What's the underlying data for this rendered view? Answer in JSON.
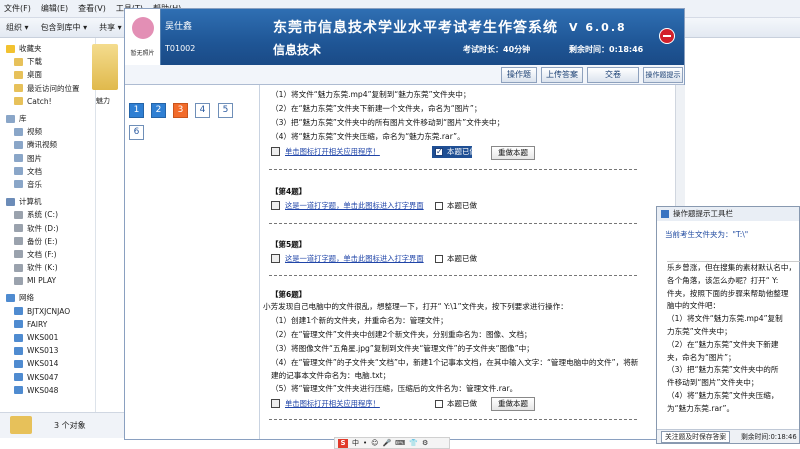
{
  "explorer": {
    "menu": [
      "文件(F)",
      "编辑(E)",
      "查看(V)",
      "工具(T)",
      "帮助(H)"
    ],
    "toolbar": [
      "组织 ▾",
      "包含到库中 ▾",
      "共享 ▾"
    ],
    "nav": [
      {
        "label": "收藏夹",
        "icon": "star-icon",
        "sub": false
      },
      {
        "label": "下载",
        "icon": "folder-icon",
        "sub": true
      },
      {
        "label": "桌面",
        "icon": "folder-icon",
        "sub": true
      },
      {
        "label": "最近访问的位置",
        "icon": "folder-icon",
        "sub": true
      },
      {
        "label": "Catch!",
        "icon": "folder-icon",
        "sub": true
      },
      {
        "label": "",
        "icon": "",
        "sub": false
      },
      {
        "label": "库",
        "icon": "library-icon",
        "sub": false
      },
      {
        "label": "视频",
        "icon": "library-icon",
        "sub": true
      },
      {
        "label": "腾讯视频",
        "icon": "library-icon",
        "sub": true
      },
      {
        "label": "图片",
        "icon": "library-icon",
        "sub": true
      },
      {
        "label": "文档",
        "icon": "library-icon",
        "sub": true
      },
      {
        "label": "音乐",
        "icon": "library-icon",
        "sub": true
      },
      {
        "label": "",
        "icon": "",
        "sub": false
      },
      {
        "label": "计算机",
        "icon": "computer-icon",
        "sub": false
      },
      {
        "label": "系统 (C:)",
        "icon": "drive-icon",
        "sub": true
      },
      {
        "label": "软件 (D:)",
        "icon": "drive-icon",
        "sub": true
      },
      {
        "label": "备份 (E:)",
        "icon": "drive-icon",
        "sub": true
      },
      {
        "label": "文档 (F:)",
        "icon": "drive-icon",
        "sub": true
      },
      {
        "label": "软件 (K:)",
        "icon": "drive-icon",
        "sub": true
      },
      {
        "label": "MI PLAY",
        "icon": "drive-icon",
        "sub": true
      },
      {
        "label": "",
        "icon": "",
        "sub": false
      },
      {
        "label": "网络",
        "icon": "network-icon",
        "sub": false
      },
      {
        "label": "BJTXJCNJAO",
        "icon": "network-icon",
        "sub": true
      },
      {
        "label": "FAIRY",
        "icon": "network-icon",
        "sub": true
      },
      {
        "label": "WKS001",
        "icon": "network-icon",
        "sub": true
      },
      {
        "label": "WKS013",
        "icon": "network-icon",
        "sub": true
      },
      {
        "label": "WKS014",
        "icon": "network-icon",
        "sub": true
      },
      {
        "label": "WKS047",
        "icon": "network-icon",
        "sub": true
      },
      {
        "label": "WKS048",
        "icon": "network-icon",
        "sub": true
      }
    ],
    "folder_label": "魅力",
    "status": "3 个对象"
  },
  "exam": {
    "photo_caption": "暂无照片",
    "student_name": "吴仕鑫",
    "student_id": "T01002",
    "system_title": "东莞市信息技术学业水平考试考生作答系统",
    "subject": "信息技术",
    "version": "V 6.0.8",
    "duration": "考试时长：40分钟",
    "remaining": "剩余时间：0:18:46",
    "toolbar": [
      "操作题",
      "上传答案",
      "交卷",
      "操作题提示"
    ],
    "questions": [
      {
        "label": "1",
        "state": "done"
      },
      {
        "label": "2",
        "state": "done"
      },
      {
        "label": "3",
        "state": "current"
      },
      {
        "label": "4",
        "state": "normal"
      },
      {
        "label": "5",
        "state": "normal"
      },
      {
        "label": "6",
        "state": "normal"
      }
    ],
    "q3_lines": [
      "（1）将文件“魅力东莞.mp4”复制到“魅力东莞”文件夹中；",
      "（2）在“魅力东莞”文件夹下新建一个文件夹，命名为“图片”；",
      "（3）把“魅力东莞”文件夹中的所有图片文件移动到“图片”文件夹中；",
      "（4）将“魅力东莞”文件夹压缩，命名为“魅力东莞.rar”。"
    ],
    "open_app_link": "单击图标打开相关应用程序！",
    "typing_link": "这是一道打字题，单击此图标进入打字界面",
    "done_label": "本题已做",
    "redo_label": "重做本题",
    "q4_head": "【第4题】",
    "q5_head": "【第5题】",
    "q6_head": "【第6题】",
    "q6_intro": "小芳发现自己电脑中的文件很乱，想整理一下，打开“ Y:\\1”文件夹，按下列要求进行操作：",
    "q6_lines": [
      "（1）创建1个新的文件夹，并重命名为：管理文件；",
      "（2）在“管理文件”文件夹中创建2个新文件夹，分别重命名为：图像、文档；",
      "（3）将图像文件“五角星.jpg”复制到文件夹“管理文件”的子文件夹“图像”中；",
      "（4）在“管理文件”的子文件夹“文档”中，新建1个记事本文档，在其中输入文字：“管理电脑中的文件”，将新建的记事本文件命名为：电脑.txt；",
      "（5）将“管理文件”文件夹进行压缩，压缩后的文件名为：管理文件.rar。"
    ]
  },
  "hint": {
    "title": "操作题提示工具栏",
    "path": "当前考生文件夹为：\"T:\\\"",
    "lines": [
      "乐乡曾涨，但在搜集的素材默认名中，",
      "各个角落，该怎么办呢？打开“ Y:",
      "件夹，按照下面的步骤来帮助他整理",
      "脑中的文件吧：",
      "（1）将文件“魅力东莞.mp4”复制",
      "力东莞”文件夹中；",
      "（2）在“魅力东莞”文件夹下新建",
      "夹，命名为“图片”；",
      "（3）把“魅力东莞”文件夹中的所",
      "件移动到“图片”文件夹中；",
      "（4）将“魅力东莞”文件夹压缩，",
      "为“魅力东莞.rar”。"
    ],
    "footer_btn": "关注题及时保存答案",
    "footer_time": "剩余时间:0:18:46"
  },
  "ime": {
    "labels": [
      "中",
      "•",
      "☺",
      "🎤",
      "⌨",
      "👕",
      "⚙"
    ]
  }
}
